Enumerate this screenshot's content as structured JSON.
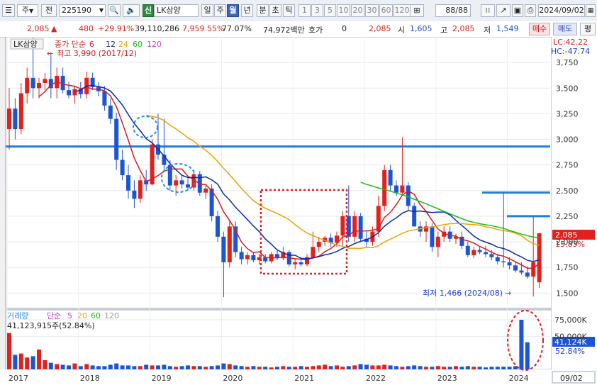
{
  "toolbar": {
    "market": "주",
    "market_dropdown": "▼",
    "prev": "전",
    "code": "225190",
    "code_dropdown": "▼",
    "sin_label": "신",
    "stock_name": "LK삼양",
    "periods": [
      "일",
      "주",
      "월",
      "년",
      "분",
      "초",
      "틱"
    ],
    "selected_period": "월",
    "intervals": [
      "1",
      "3",
      "5",
      "10",
      "20",
      "30",
      "60",
      "120"
    ],
    "count": "88",
    "count_total": "/88",
    "date": "2024/09/02"
  },
  "info": {
    "price": "2,085",
    "change": "480",
    "change_pct": "+29.91%",
    "volume": "39,110,286",
    "volume_pct": "7,959.55%",
    "pct2": "77.07%",
    "amount": "74,972백만",
    "hoga_label": "호가",
    "hoga_value": "0",
    "cur": "2,085",
    "open_label": "시",
    "open": "1,605",
    "high_label": "고",
    "high": "2,085",
    "low_label": "저",
    "low": "1,549",
    "buy": "매수",
    "sell": "매도",
    "avg": "평"
  },
  "legend": {
    "stock": "LK삼양",
    "ma_title": "종가 단순",
    "ma_periods": [
      "6",
      "12",
      "24",
      "60",
      "120"
    ],
    "ma_colors": [
      "#e01818",
      "#0a2aa8",
      "#f0a000",
      "#12c012",
      "#d040d0"
    ],
    "high_note": "최고 3,990 (2017/12)",
    "low_note": "최저 1,466 (2024/08)"
  },
  "right": {
    "lc": "LC:42.22",
    "hc": "HC:-47.74",
    "price_tag": "2,085",
    "pct_tag": "15.83%",
    "vol_tag": "41,124K",
    "vol_pct_tag": "52.84%",
    "date_tag": "09/02"
  },
  "volume_panel": {
    "title": "거래량",
    "ma_title": "단순",
    "ma_periods": [
      "5",
      "20",
      "60",
      "120"
    ],
    "current": "41,123,915주(52.84%)"
  },
  "chart_data": {
    "type": "candlestick",
    "price_axis": {
      "ticks": [
        3750,
        3500,
        3250,
        3000,
        2750,
        2500,
        2250,
        2000,
        1750,
        1500
      ]
    },
    "volume_axis": {
      "ticks": [
        "75,000K",
        "50,000K"
      ]
    },
    "years": [
      "2017",
      "2018",
      "2019",
      "2020",
      "2021",
      "2022",
      "2023",
      "2024"
    ],
    "horizontal_lines": [
      2930,
      2480,
      2250
    ],
    "colors": {
      "up": "#e3201b",
      "down": "#1c54d6",
      "hline": "#1f7fe0"
    },
    "candles": [
      {
        "o": 3100,
        "h": 3500,
        "l": 2900,
        "c": 3300
      },
      {
        "o": 3300,
        "h": 3400,
        "l": 3000,
        "c": 3100
      },
      {
        "o": 3100,
        "h": 3550,
        "l": 3050,
        "c": 3450
      },
      {
        "o": 3450,
        "h": 3700,
        "l": 3350,
        "c": 3600
      },
      {
        "o": 3600,
        "h": 3990,
        "l": 3400,
        "c": 3500
      },
      {
        "o": 3500,
        "h": 3600,
        "l": 3400,
        "c": 3550
      },
      {
        "o": 3550,
        "h": 3650,
        "l": 3480,
        "c": 3590
      },
      {
        "o": 3590,
        "h": 3850,
        "l": 3400,
        "c": 3500
      },
      {
        "o": 3500,
        "h": 3700,
        "l": 3400,
        "c": 3620
      },
      {
        "o": 3620,
        "h": 3700,
        "l": 3450,
        "c": 3480
      },
      {
        "o": 3480,
        "h": 3560,
        "l": 3400,
        "c": 3430
      },
      {
        "o": 3430,
        "h": 3520,
        "l": 3350,
        "c": 3490
      },
      {
        "o": 3490,
        "h": 3560,
        "l": 3400,
        "c": 3440
      },
      {
        "o": 3440,
        "h": 3660,
        "l": 3400,
        "c": 3600
      },
      {
        "o": 3600,
        "h": 3650,
        "l": 3480,
        "c": 3510
      },
      {
        "o": 3510,
        "h": 3560,
        "l": 3420,
        "c": 3470
      },
      {
        "o": 3470,
        "h": 3520,
        "l": 3280,
        "c": 3330
      },
      {
        "o": 3330,
        "h": 3400,
        "l": 3150,
        "c": 3200
      },
      {
        "o": 3200,
        "h": 3260,
        "l": 2700,
        "c": 2800
      },
      {
        "o": 2800,
        "h": 2900,
        "l": 2600,
        "c": 2650
      },
      {
        "o": 2650,
        "h": 2750,
        "l": 2420,
        "c": 2500
      },
      {
        "o": 2500,
        "h": 2600,
        "l": 2330,
        "c": 2420
      },
      {
        "o": 2420,
        "h": 2650,
        "l": 2380,
        "c": 2600
      },
      {
        "o": 2600,
        "h": 2700,
        "l": 2500,
        "c": 2560
      },
      {
        "o": 2560,
        "h": 3000,
        "l": 2550,
        "c": 2950
      },
      {
        "o": 2950,
        "h": 3250,
        "l": 2800,
        "c": 2850
      },
      {
        "o": 2850,
        "h": 3200,
        "l": 2700,
        "c": 2750
      },
      {
        "o": 2750,
        "h": 2800,
        "l": 2500,
        "c": 2550
      },
      {
        "o": 2550,
        "h": 2650,
        "l": 2450,
        "c": 2600
      },
      {
        "o": 2600,
        "h": 2650,
        "l": 2520,
        "c": 2560
      },
      {
        "o": 2560,
        "h": 2620,
        "l": 2500,
        "c": 2530
      },
      {
        "o": 2530,
        "h": 2700,
        "l": 2500,
        "c": 2660
      },
      {
        "o": 2660,
        "h": 2690,
        "l": 2450,
        "c": 2480
      },
      {
        "o": 2480,
        "h": 2550,
        "l": 2420,
        "c": 2520
      },
      {
        "o": 2520,
        "h": 2560,
        "l": 2200,
        "c": 2250
      },
      {
        "o": 2250,
        "h": 2300,
        "l": 2000,
        "c": 2050
      },
      {
        "o": 2050,
        "h": 2100,
        "l": 1460,
        "c": 1800
      },
      {
        "o": 1800,
        "h": 2200,
        "l": 1750,
        "c": 2150
      },
      {
        "o": 2150,
        "h": 2200,
        "l": 1850,
        "c": 1900
      },
      {
        "o": 1900,
        "h": 1950,
        "l": 1780,
        "c": 1830
      },
      {
        "o": 1830,
        "h": 1900,
        "l": 1780,
        "c": 1870
      },
      {
        "o": 1870,
        "h": 1900,
        "l": 1800,
        "c": 1820
      },
      {
        "o": 1820,
        "h": 1880,
        "l": 1780,
        "c": 1850
      },
      {
        "o": 1850,
        "h": 1880,
        "l": 1790,
        "c": 1810
      },
      {
        "o": 1810,
        "h": 1900,
        "l": 1790,
        "c": 1880
      },
      {
        "o": 1880,
        "h": 1920,
        "l": 1820,
        "c": 1840
      },
      {
        "o": 1840,
        "h": 1950,
        "l": 1820,
        "c": 1900
      },
      {
        "o": 1900,
        "h": 1920,
        "l": 1760,
        "c": 1780
      },
      {
        "o": 1780,
        "h": 1830,
        "l": 1730,
        "c": 1800
      },
      {
        "o": 1800,
        "h": 1850,
        "l": 1760,
        "c": 1780
      },
      {
        "o": 1780,
        "h": 1880,
        "l": 1760,
        "c": 1850
      },
      {
        "o": 1850,
        "h": 2100,
        "l": 1830,
        "c": 1950
      },
      {
        "o": 1950,
        "h": 2050,
        "l": 1900,
        "c": 2000
      },
      {
        "o": 2000,
        "h": 2060,
        "l": 1960,
        "c": 2040
      },
      {
        "o": 2040,
        "h": 2080,
        "l": 1950,
        "c": 1990
      },
      {
        "o": 1990,
        "h": 2100,
        "l": 1950,
        "c": 2060
      },
      {
        "o": 2060,
        "h": 2300,
        "l": 1950,
        "c": 2250
      },
      {
        "o": 2250,
        "h": 2550,
        "l": 2000,
        "c": 2050
      },
      {
        "o": 2050,
        "h": 2300,
        "l": 2000,
        "c": 2250
      },
      {
        "o": 2250,
        "h": 2280,
        "l": 2000,
        "c": 2030
      },
      {
        "o": 2030,
        "h": 2100,
        "l": 1950,
        "c": 2000
      },
      {
        "o": 2000,
        "h": 2150,
        "l": 1960,
        "c": 2100
      },
      {
        "o": 2100,
        "h": 2450,
        "l": 2050,
        "c": 2350
      },
      {
        "o": 2350,
        "h": 2750,
        "l": 2300,
        "c": 2700
      },
      {
        "o": 2700,
        "h": 2750,
        "l": 2500,
        "c": 2550
      },
      {
        "o": 2550,
        "h": 2600,
        "l": 2450,
        "c": 2480
      },
      {
        "o": 2480,
        "h": 3020,
        "l": 2450,
        "c": 2550
      },
      {
        "o": 2550,
        "h": 2580,
        "l": 2300,
        "c": 2350
      },
      {
        "o": 2350,
        "h": 2380,
        "l": 2150,
        "c": 2150
      },
      {
        "o": 2150,
        "h": 2200,
        "l": 2050,
        "c": 2100
      },
      {
        "o": 2100,
        "h": 2200,
        "l": 2000,
        "c": 2150
      },
      {
        "o": 2150,
        "h": 2180,
        "l": 1900,
        "c": 1950
      },
      {
        "o": 1950,
        "h": 2100,
        "l": 1850,
        "c": 2050
      },
      {
        "o": 2050,
        "h": 2150,
        "l": 2000,
        "c": 2100
      },
      {
        "o": 2100,
        "h": 2150,
        "l": 2000,
        "c": 2030
      },
      {
        "o": 2030,
        "h": 2080,
        "l": 1980,
        "c": 2050
      },
      {
        "o": 2050,
        "h": 2100,
        "l": 1930,
        "c": 1960
      },
      {
        "o": 1960,
        "h": 2000,
        "l": 1850,
        "c": 1870
      },
      {
        "o": 1870,
        "h": 1950,
        "l": 1840,
        "c": 1920
      },
      {
        "o": 1920,
        "h": 1960,
        "l": 1880,
        "c": 1900
      },
      {
        "o": 1900,
        "h": 1960,
        "l": 1850,
        "c": 1880
      },
      {
        "o": 1880,
        "h": 1920,
        "l": 1820,
        "c": 1850
      },
      {
        "o": 1850,
        "h": 1880,
        "l": 1780,
        "c": 1810
      },
      {
        "o": 1810,
        "h": 2480,
        "l": 1750,
        "c": 1800
      },
      {
        "o": 1800,
        "h": 1850,
        "l": 1730,
        "c": 1770
      },
      {
        "o": 1770,
        "h": 1800,
        "l": 1700,
        "c": 1720
      },
      {
        "o": 1720,
        "h": 1800,
        "l": 1680,
        "c": 1700
      },
      {
        "o": 1700,
        "h": 1760,
        "l": 1640,
        "c": 1660
      },
      {
        "o": 1660,
        "h": 2250,
        "l": 1466,
        "c": 1800
      },
      {
        "o": 1605,
        "h": 2085,
        "l": 1549,
        "c": 2085
      }
    ],
    "volumes": [
      55,
      22,
      24,
      18,
      20,
      30,
      14,
      10,
      8,
      7,
      6,
      9,
      5,
      8,
      6,
      5,
      5,
      7,
      9,
      6,
      6,
      5,
      5,
      7,
      6,
      6,
      7,
      5,
      4,
      5,
      6,
      5,
      5,
      4,
      5,
      6,
      9,
      8,
      6,
      5,
      4,
      5,
      4,
      4,
      3,
      4,
      5,
      4,
      4,
      5,
      4,
      5,
      6,
      7,
      5,
      6,
      4,
      5,
      6,
      8,
      7,
      6,
      6,
      7,
      6,
      5,
      4,
      5,
      6,
      5,
      4,
      4,
      5,
      4,
      4,
      5,
      4,
      5,
      4,
      4,
      3,
      4,
      4,
      4,
      4,
      5,
      75,
      41
    ]
  }
}
